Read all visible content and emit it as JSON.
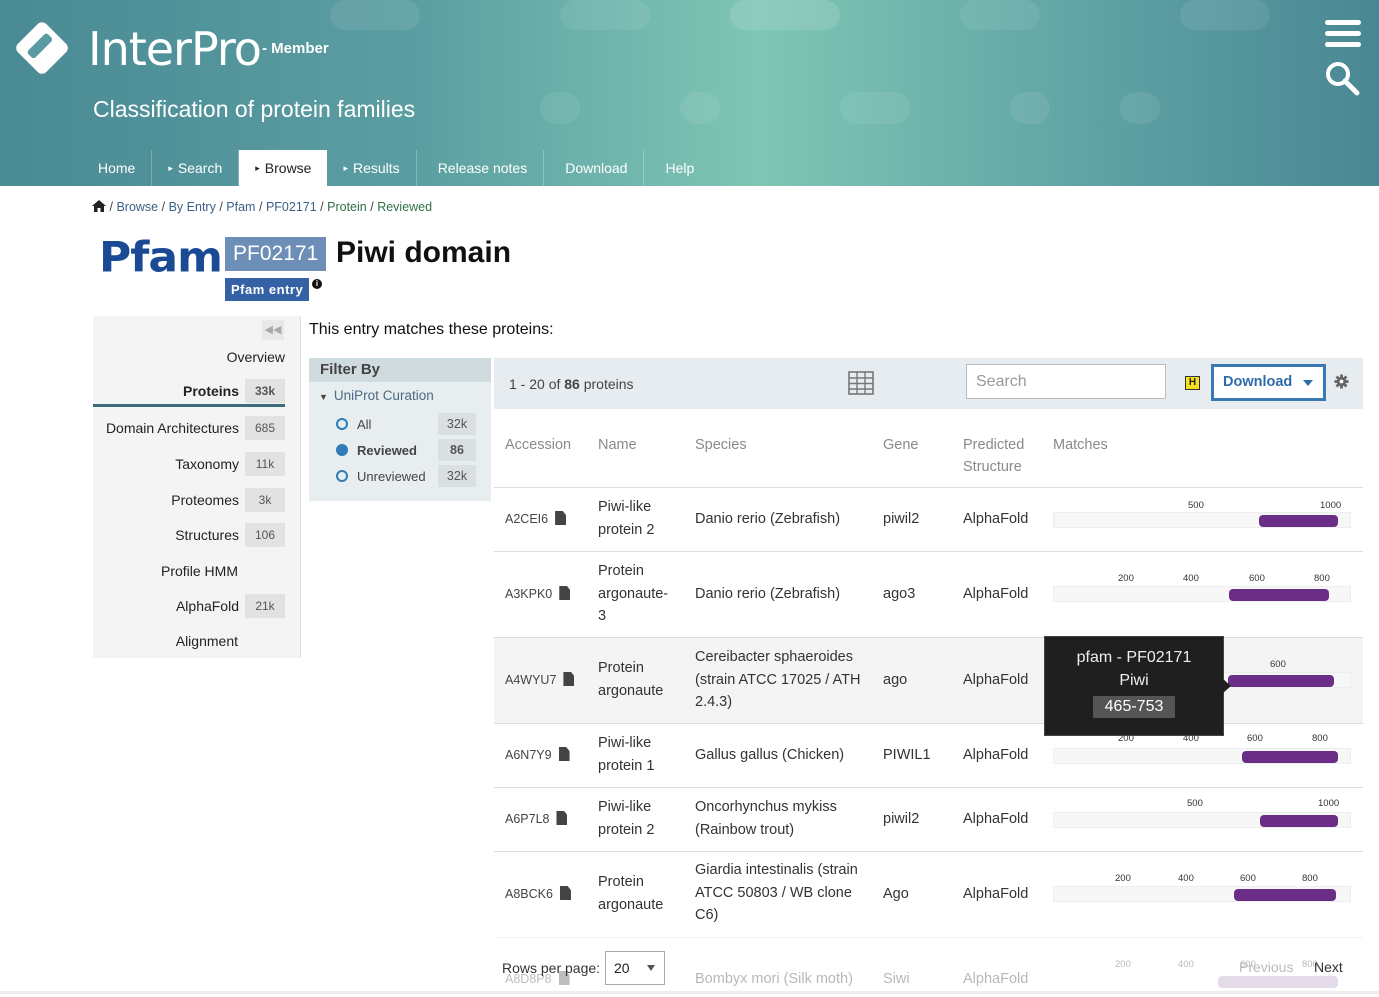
{
  "header": {
    "logo_text": "InterPro",
    "logo_sub": "- Member",
    "tagline": "Classification of protein families",
    "nav": [
      {
        "label": "Home",
        "arrow": ""
      },
      {
        "label": "Search",
        "arrow": "▸"
      },
      {
        "label": "Browse",
        "arrow": "▸"
      },
      {
        "label": "Results",
        "arrow": "▸"
      },
      {
        "label": "Release notes",
        "arrow": ""
      },
      {
        "label": "Download",
        "arrow": ""
      },
      {
        "label": "Help",
        "arrow": ""
      }
    ]
  },
  "breadcrumb": {
    "parts": [
      "Browse",
      "By Entry",
      "Pfam",
      "PF02171",
      "Protein",
      "Reviewed"
    ],
    "sep": "/"
  },
  "entry": {
    "db_logo": "Pfam",
    "accession": "PF02171",
    "title": "Piwi domain",
    "type_badge": "Pfam entry",
    "info_icon": "i"
  },
  "sidebar": {
    "items": [
      {
        "label": "Overview",
        "count": ""
      },
      {
        "label": "Proteins",
        "count": "33k"
      },
      {
        "label": "Domain Architectures",
        "count": "685"
      },
      {
        "label": "Taxonomy",
        "count": "11k"
      },
      {
        "label": "Proteomes",
        "count": "3k"
      },
      {
        "label": "Structures",
        "count": "106"
      },
      {
        "label": "Profile HMM",
        "count": ""
      },
      {
        "label": "AlphaFold",
        "count": "21k"
      },
      {
        "label": "Alignment",
        "count": ""
      }
    ]
  },
  "main": {
    "intro": "This entry matches these proteins:"
  },
  "filter": {
    "title": "Filter By",
    "section": "UniProt Curation",
    "options": [
      {
        "label": "All",
        "count": "32k",
        "selected": false
      },
      {
        "label": "Reviewed",
        "count": "86",
        "selected": true
      },
      {
        "label": "Unreviewed",
        "count": "32k",
        "selected": false
      }
    ]
  },
  "table": {
    "count_prefix": "1 - 20 of",
    "count_total": "86",
    "count_suffix": "proteins",
    "search_placeholder": "Search",
    "h_icon": "H",
    "download_label": "Download",
    "columns": [
      "Accession",
      "Name",
      "Species",
      "Gene",
      "Predicted Structure",
      "Matches"
    ],
    "rows": [
      {
        "accession": "A2CEI6",
        "name": "Piwi-like protein 2",
        "species": "Danio rerio (Zebrafish)",
        "gene": "piwil2",
        "structure": "AlphaFold",
        "ticks": [
          "500",
          "1000"
        ]
      },
      {
        "accession": "A3KPK0",
        "name": "Protein argonaute-3",
        "species": "Danio rerio (Zebrafish)",
        "gene": "ago3",
        "structure": "AlphaFold",
        "ticks": [
          "200",
          "400",
          "600",
          "800"
        ]
      },
      {
        "accession": "A4WYU7",
        "name": "Protein argonaute",
        "species": "Cereibacter sphaeroides (strain ATCC 17025 / ATH 2.4.3)",
        "gene": "ago",
        "structure": "AlphaFold",
        "ticks": [
          "600"
        ]
      },
      {
        "accession": "A6N7Y9",
        "name": "Piwi-like protein 1",
        "species": "Gallus gallus (Chicken)",
        "gene": "PIWIL1",
        "structure": "AlphaFold",
        "ticks": [
          "200",
          "400",
          "600",
          "800"
        ]
      },
      {
        "accession": "A6P7L8",
        "name": "Piwi-like protein 2",
        "species": "Oncorhynchus mykiss (Rainbow trout)",
        "gene": "piwil2",
        "structure": "AlphaFold",
        "ticks": [
          "500",
          "1000"
        ]
      },
      {
        "accession": "A8BCK6",
        "name": "Protein argonaute",
        "species": "Giardia intestinalis (strain ATCC 50803 / WB clone C6)",
        "gene": "Ago",
        "structure": "AlphaFold",
        "ticks": [
          "200",
          "400",
          "600",
          "800"
        ]
      },
      {
        "accession": "A8D8P8",
        "name": "",
        "species": "Bombyx mori (Silk moth)",
        "gene": "Siwi",
        "structure": "AlphaFold",
        "ticks": [
          "200",
          "400",
          "600",
          "800"
        ]
      }
    ]
  },
  "tooltip": {
    "line1": "pfam - PF02171",
    "line2": "Piwi",
    "range": "465-753"
  },
  "pager": {
    "rows_label": "Rows per page:",
    "rows_value": "20",
    "previous": "Previous",
    "next": "Next"
  }
}
